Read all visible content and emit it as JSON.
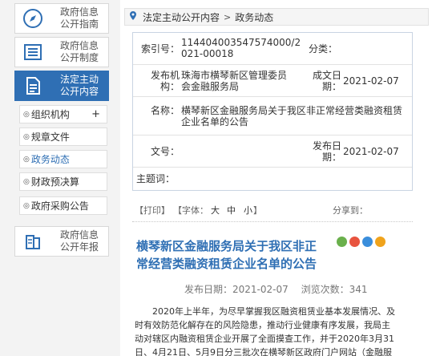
{
  "sidebar": {
    "categories": [
      {
        "line1": "政府信息",
        "line2": "公开指南",
        "icon": "compass-icon"
      },
      {
        "line1": "政府信息",
        "line2": "公开制度",
        "icon": "list-icon"
      },
      {
        "line1": "法定主动",
        "line2": "公开内容",
        "icon": "document-icon"
      },
      {
        "line1": "政府信息",
        "line2": "公开年报",
        "icon": "report-icon"
      }
    ],
    "subitems": [
      {
        "label": "组织机构",
        "expand": "+"
      },
      {
        "label": "规章文件"
      },
      {
        "label": "政务动态"
      },
      {
        "label": "财政预决算"
      },
      {
        "label": "政府采购公告"
      }
    ],
    "bullet": "◎"
  },
  "breadcrumb": {
    "item1": "法定主动公开内容",
    "separator": ">",
    "item2": "政务动态"
  },
  "info": {
    "index_label": "索引号：",
    "index_value_1": "114404003547574000/2",
    "index_value_2": "021-00018",
    "category_label": "分类：",
    "category_value": "",
    "publisher_label_1": "发布机",
    "publisher_label_2": "构：",
    "publisher_value_1": "珠海市横琴新区管理委员",
    "publisher_value_2": "会金融服务局",
    "created_label_1": "成文日",
    "created_label_2": "期：",
    "created_value": "2021-02-07",
    "name_label": "名称：",
    "name_value_1": "横琴新区金融服务局关于我区非正常经营类融资租赁",
    "name_value_2": "企业名单的公告",
    "docno_label": "文号：",
    "docno_value": "",
    "pubdate_label_1": "发布日",
    "pubdate_label_2": "期：",
    "pubdate_value": "2021-02-07",
    "keywords_label": "主题词：",
    "keywords_value": ""
  },
  "tools": {
    "print": "【打印】",
    "font_open": "【字体：",
    "big": "大",
    "medium": "中",
    "small": "小",
    "font_close": "】",
    "share": "分享到："
  },
  "article": {
    "title_1": "横琴新区金融服务局关于我区非正",
    "title_2": "常经营类融资租赁企业名单的公告",
    "date_label": "发布日期：",
    "date": "2021-02-07",
    "views_label": "浏览次数：",
    "views": "341",
    "para_1": "2020年上半年，为尽早掌握我区融资租赁业基本发展情况、及",
    "para_2": "时有效防范化解存在的风险隐患，推动行业健康有序发展，我局主",
    "para_3": "动对辖区内融资租赁企业开展了全面摸查工作，并于2020年3月31",
    "para_4": "日、4月21日、5月9日分三批次在横琴新区政府门户网站（金融服"
  },
  "colors": {
    "accent": "#2f6fb4",
    "share": [
      "#6ab04c",
      "#e8543f",
      "#3a8edc",
      "#f0a31c"
    ]
  }
}
